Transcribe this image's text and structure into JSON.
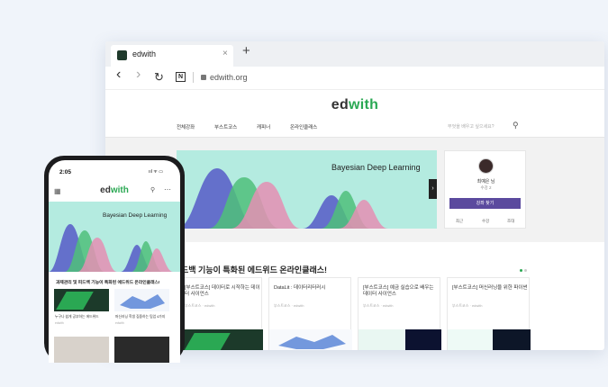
{
  "browser": {
    "tab_title": "edwith",
    "tab_close": "×",
    "new_tab": "+",
    "nav": {
      "back": "‹",
      "forward": "›",
      "reload": "↻",
      "naver": "N"
    },
    "url": "edwith.org"
  },
  "site": {
    "logo_ed": "ed",
    "logo_with": "with",
    "menu": [
      "전체강좌",
      "부스트코스",
      "캐피너",
      "온라인클래스"
    ],
    "search_placeholder": "무엇을 배우고 싶으세요?",
    "banner_title": "Bayesian Deep Learning",
    "profile": {
      "name": "최예은 님",
      "sub": "수강 2",
      "button": "강좌 찾기",
      "links": [
        "최근",
        "수강",
        "조대"
      ]
    },
    "section_title": "드백 기능이 특화된 에드위드 온라인클래스!",
    "cards": [
      {
        "title": "[부스트코스] 데이터로 시작하는 데이터 사이언스",
        "meta": "부스트코스 · edwith"
      },
      {
        "title": "DataLit : 데이터리터러시",
        "meta": "부스트코스 · edwith"
      },
      {
        "title": "[부스트코스] 예금 실습으로 배우는 데이터 사이언스",
        "meta": "부스트코스 · edwith"
      },
      {
        "title": "[부스트코스] 머신러닝을 위한 파이썬",
        "meta": "부스트코스 · edwith"
      }
    ]
  },
  "phone": {
    "time": "2:05",
    "status": "ııl ᯤ ▭",
    "logo_ed": "ed",
    "logo_with": "with",
    "banner_title": "Bayesian Deep Learning",
    "heading": "과제관리 및 피드백 기능이 특화된 에드위드 온라인클래스!",
    "thumbs": [
      {
        "caption": "누구나 쉽게 공부하는 에드위드",
        "sub": "edwith"
      },
      {
        "caption": "머신러닝 학생 집중하는 팀업 4가지",
        "sub": "edwith"
      }
    ]
  },
  "colors": {
    "brand_green": "#2aa853",
    "mint": "#b4ebe0",
    "purple": "#5b4a9e"
  }
}
